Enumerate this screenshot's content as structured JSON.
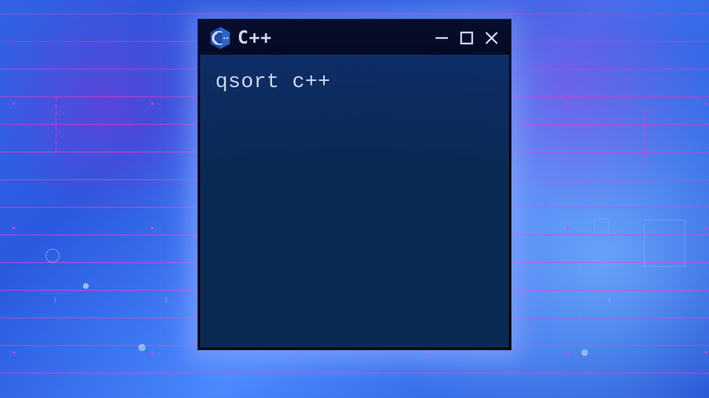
{
  "window": {
    "title": "C++",
    "content": "qsort c++",
    "icons": {
      "logo": "cpp-hex-logo-icon",
      "minimize": "minimize-icon",
      "maximize": "maximize-icon",
      "close": "close-icon"
    },
    "colors": {
      "titlebar_bg": "#000000",
      "body_bg": "#0a2a53",
      "text": "#e9eef6"
    }
  }
}
